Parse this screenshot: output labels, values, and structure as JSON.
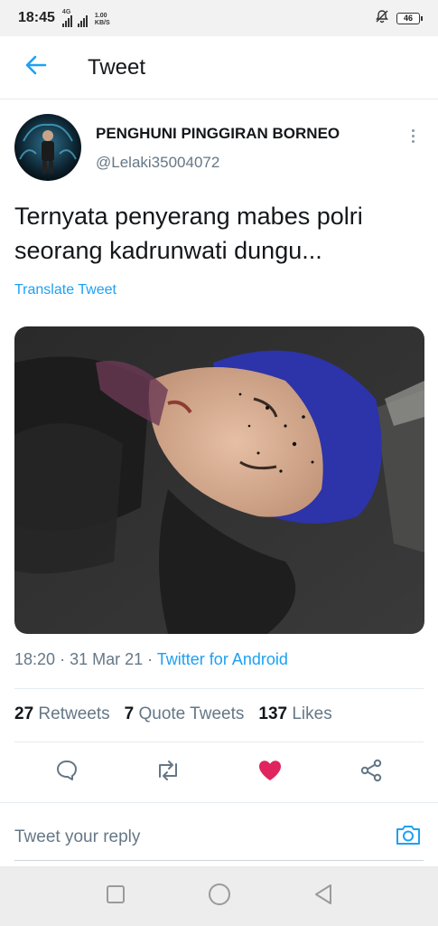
{
  "status_bar": {
    "time": "18:45",
    "network_label": "4G",
    "speed_value": "1.00",
    "speed_unit": "KB/S",
    "battery": "46"
  },
  "header": {
    "title": "Tweet"
  },
  "tweet": {
    "author_name": "PENGHUNI PINGGIRAN BORNEO",
    "author_handle": "@Lelaki35004072",
    "text": "Ternyata penyerang mabes polri seorang kadrunwati dungu...",
    "translate_label": "Translate Tweet",
    "time": "18:20",
    "date": "31 Mar 21",
    "source": "Twitter for Android",
    "stats": {
      "retweets_count": "27",
      "retweets_label": "Retweets",
      "quote_count": "7",
      "quote_label": "Quote Tweets",
      "likes_count": "137",
      "likes_label": "Likes"
    },
    "liked": true
  },
  "reply": {
    "placeholder": "Tweet your reply"
  },
  "icons": {
    "back": "arrow-left-icon",
    "more": "vertical-dots-icon",
    "reply": "speech-bubble-icon",
    "retweet": "retweet-icon",
    "like": "heart-icon",
    "share": "share-icon",
    "camera": "camera-icon",
    "nav_recent": "square-icon",
    "nav_home": "circle-icon",
    "nav_back": "triangle-back-icon"
  },
  "colors": {
    "accent": "#1da1f2",
    "like": "#e0245e",
    "secondary_text": "#657786"
  }
}
